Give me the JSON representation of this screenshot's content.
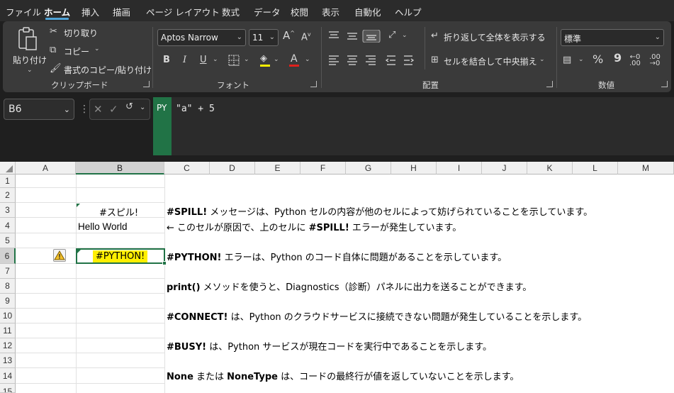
{
  "menu": [
    "ファイル",
    "ホーム",
    "挿入",
    "描画",
    "ページ レイアウト",
    "数式",
    "データ",
    "校閲",
    "表示",
    "自動化",
    "ヘルプ"
  ],
  "ribbon": {
    "clipboard": {
      "paste": "貼り付け",
      "cut": "切り取り",
      "copy": "コピー",
      "format_painter": "書式のコピー/貼り付け",
      "label": "クリップボード"
    },
    "font": {
      "family": "Aptos Narrow",
      "size": "11",
      "bold": "B",
      "italic": "I",
      "underline": "U",
      "color_letter": "A",
      "grow": "A",
      "shrink": "A",
      "label": "フォント"
    },
    "alignment": {
      "wrap": "折り返して全体を表示する",
      "merge": "セルを結合して中央揃え",
      "label": "配置"
    },
    "number": {
      "format": "標準",
      "percent": "%",
      "comma": "9",
      "label": "数値"
    }
  },
  "formula_bar": {
    "name_box": "B6",
    "py_tag": "PY",
    "formula": "\"a\" + 5"
  },
  "columns": [
    "A",
    "B",
    "C",
    "D",
    "E",
    "F",
    "G",
    "H",
    "I",
    "J",
    "K",
    "L",
    "M"
  ],
  "rows": [
    "1",
    "2",
    "3",
    "4",
    "5",
    "6",
    "7",
    "8",
    "9",
    "10",
    "11",
    "12",
    "13",
    "14",
    "15"
  ],
  "cells": {
    "b3": "#スピル!",
    "b4": "Hello World",
    "b6": "#PYTHON!",
    "c3_bold": "#SPILL!",
    "c3_rest": " メッセージは、Python セルの内容が他のセルによって妨げられていることを示しています。",
    "c4_pre": "← このセルが原因で、上のセルに ",
    "c4_bold": "#SPILL!",
    "c4_post": " エラーが発生しています。",
    "c6_bold": "#PYTHON!",
    "c6_rest": " エラーは、Python のコード自体に問題があることを示しています。",
    "c8_bold": "print()",
    "c8_rest": " メソッドを使うと、Diagnostics（診断）パネルに出力を送ることができます。",
    "c10_bold": "#CONNECT!",
    "c10_rest": " は、Python のクラウドサービスに接続できない問題が発生していることを示します。",
    "c12_bold": "#BUSY!",
    "c12_rest": " は、Python サービスが現在コードを実行中であることを示します。",
    "c14_bold1": "None",
    "c14_mid": " または ",
    "c14_bold2": "NoneType",
    "c14_rest": " は、コードの最終行が値を返していないことを示します。"
  },
  "colors": {
    "accent": "#217346",
    "error_highlight": "#ffef00"
  }
}
